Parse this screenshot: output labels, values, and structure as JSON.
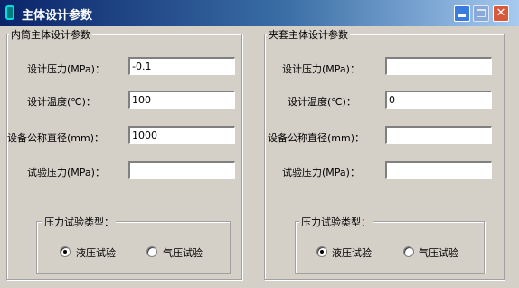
{
  "window": {
    "title": "主体设计参数",
    "minimize": "",
    "maximize": "",
    "close": "✕"
  },
  "inner": {
    "group_title": "内筒主体设计参数",
    "pressure_label": "设计压力(MPa)：",
    "pressure_value": "-0.1",
    "temperature_label": "设计温度(℃)：",
    "temperature_value": "100",
    "diameter_label": "设备公称直径(mm)：",
    "diameter_value": "1000",
    "test_pressure_label": "试验压力(MPa)：",
    "test_pressure_value": "",
    "test_type_title": "压力试验类型：",
    "hydraulic_label": "液压试验",
    "pneumatic_label": "气压试验",
    "selected": "hydraulic"
  },
  "jacket": {
    "group_title": "夹套主体设计参数",
    "pressure_label": "设计压力(MPa)：",
    "pressure_value": "",
    "temperature_label": "设计温度(℃)：",
    "temperature_value": "0",
    "diameter_label": "设备公称直径(mm)：",
    "diameter_value": "",
    "test_pressure_label": "试验压力(MPa)：",
    "test_pressure_value": "",
    "test_type_title": "压力试验类型：",
    "hydraulic_label": "液压试验",
    "pneumatic_label": "气压试验",
    "selected": "hydraulic"
  }
}
